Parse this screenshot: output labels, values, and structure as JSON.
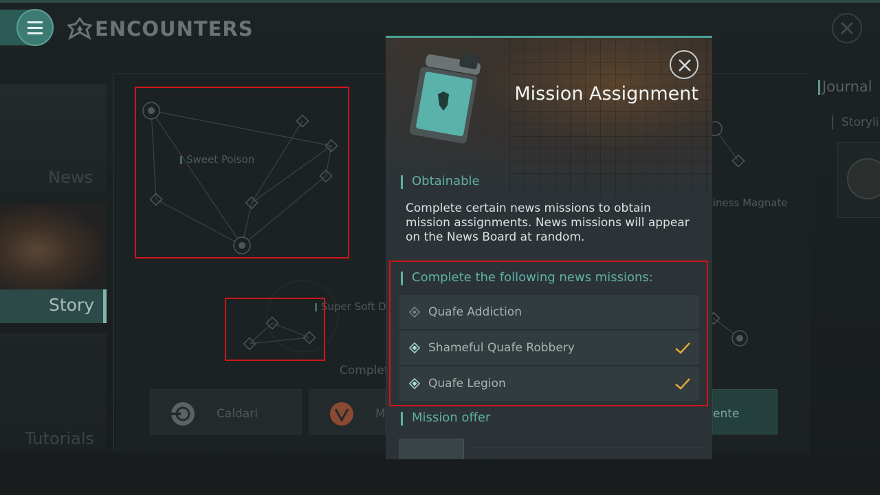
{
  "header": {
    "title": "ENCOUNTERS",
    "menu_icon": "hamburger-icon",
    "logo_icon": "faction-wing-icon"
  },
  "nav": {
    "news_label": "News",
    "story_label": "Story",
    "tutorials_label": "Tutorials"
  },
  "map": {
    "labels": {
      "sweet_poison": "Sweet Poison",
      "super_soft": "Super Soft D",
      "business_magnate": "siness Magnate"
    },
    "complete_text": "Complet"
  },
  "factions": [
    {
      "name": "Caldari",
      "icon": "caldari-logo-icon"
    },
    {
      "name": "M",
      "icon": "minmatar-logo-icon"
    },
    {
      "name": "ente",
      "icon": "gallente-logo-icon"
    }
  ],
  "journal": {
    "title": "Journal",
    "storyline": "Storyli"
  },
  "dialog": {
    "title": "Mission Assignment",
    "obtainable_heading": "Obtainable",
    "description": "Complete certain news missions to obtain mission assignments. News missions will appear on the News Board at random.",
    "missions_heading": "Complete the following news missions:",
    "missions": [
      {
        "name": "Quafe Addiction",
        "completed": false
      },
      {
        "name": "Shameful Quafe Robbery",
        "completed": true
      },
      {
        "name": "Quafe Legion",
        "completed": true
      }
    ],
    "offer_heading": "Mission offer"
  },
  "colors": {
    "accent": "#5fb0a4",
    "highlight_box": "#d0141a",
    "check": "#e0a83a"
  }
}
